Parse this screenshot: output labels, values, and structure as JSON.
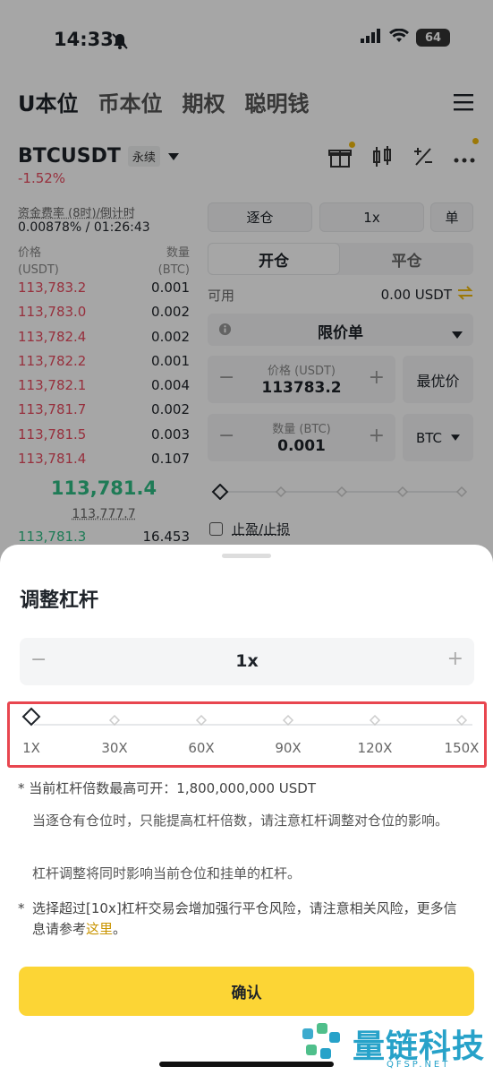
{
  "status_bar": {
    "time": "14:33",
    "battery": "64"
  },
  "top_tabs": [
    "U本位",
    "币本位",
    "期权",
    "聪明钱"
  ],
  "pair": {
    "name": "BTCUSDT",
    "badge": "永续",
    "change": "-1.52%"
  },
  "funding": {
    "label": "资金费率 (8时)/倒计时",
    "value": "0.00878% / 01:26:43"
  },
  "orderbook": {
    "price_header": "价格",
    "price_unit": "(USDT)",
    "qty_header": "数量",
    "qty_unit": "(BTC)",
    "asks": [
      {
        "price": "113,783.2",
        "qty": "0.001"
      },
      {
        "price": "113,783.0",
        "qty": "0.002"
      },
      {
        "price": "113,782.4",
        "qty": "0.002"
      },
      {
        "price": "113,782.2",
        "qty": "0.001"
      },
      {
        "price": "113,782.1",
        "qty": "0.004"
      },
      {
        "price": "113,781.7",
        "qty": "0.002"
      },
      {
        "price": "113,781.5",
        "qty": "0.003"
      },
      {
        "price": "113,781.4",
        "qty": "0.107"
      }
    ],
    "last_price": "113,781.4",
    "mark_price": "113,777.7",
    "bid": {
      "price": "113,781.3",
      "qty": "16.453"
    }
  },
  "trade_panel": {
    "margin_mode": "逐仓",
    "leverage": "1x",
    "position_mode": "单",
    "open_label": "开仓",
    "close_label": "平仓",
    "available_label": "可用",
    "available_value": "0.00 USDT",
    "order_type": "限价单",
    "price_label": "价格 (USDT)",
    "price_value": "113783.2",
    "best_price": "最优价",
    "qty_label": "数量 (BTC)",
    "qty_value": "0.001",
    "qty_unit": "BTC",
    "tpsl_label": "止盈/止损"
  },
  "sheet": {
    "title": "调整杠杆",
    "leverage_value": "1x",
    "slider_ticks": [
      "1X",
      "30X",
      "60X",
      "90X",
      "120X",
      "150X"
    ],
    "slider_level": 1,
    "note1": "当前杠杆倍数最高可开：1,800,000,000 USDT",
    "note2": "当逐仓有仓位时，只能提高杠杆倍数，请注意杠杆调整对仓位的影响。",
    "note3": "杠杆调整将同时影响当前仓位和挂单的杠杆。",
    "note4_prefix": "选择超过[10x]杠杆交易会增加强行平仓风险，请注意相关风险，更多信息请参考",
    "note4_link": "这里",
    "note4_suffix": "。",
    "confirm": "确认"
  },
  "watermark": {
    "text": "量链科技",
    "sub": "QFSP.NET"
  },
  "colors": {
    "accent": "#fcd535",
    "sell": "#e84a5f",
    "buy": "#2ebd85",
    "highlight": "#e8464f"
  }
}
